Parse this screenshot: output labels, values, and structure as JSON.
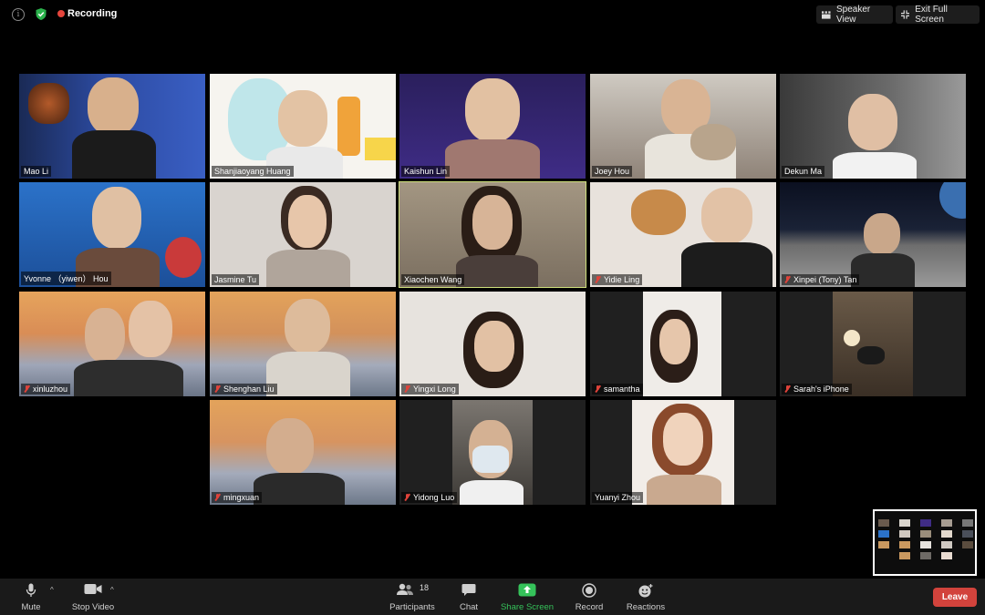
{
  "topbar": {
    "recording_label": "Recording",
    "speaker_view_label": "Speaker View",
    "exit_fullscreen_label": "Exit Full Screen"
  },
  "participants": [
    {
      "name": "Mao Li",
      "muted": false
    },
    {
      "name": "Shanjiaoyang Huang",
      "muted": false
    },
    {
      "name": "Kaishun Lin",
      "muted": false
    },
    {
      "name": "Joey Hou",
      "muted": false
    },
    {
      "name": "Dekun Ma",
      "muted": false
    },
    {
      "name": "Yvonne （yiwen） Hou",
      "muted": false
    },
    {
      "name": "Jasmine Tu",
      "muted": false
    },
    {
      "name": "Xiaochen Wang",
      "muted": false,
      "active_speaker": true
    },
    {
      "name": "Yidie Ling",
      "muted": true
    },
    {
      "name": "Xinpei (Tony) Tan",
      "muted": true
    },
    {
      "name": "xinluzhou",
      "muted": true
    },
    {
      "name": "Shenghan Liu",
      "muted": true
    },
    {
      "name": "Yingxi Long",
      "muted": true
    },
    {
      "name": "samantha",
      "muted": true
    },
    {
      "name": "Sarah's iPhone",
      "muted": true
    },
    {
      "name": "mingxuan",
      "muted": true
    },
    {
      "name": "Yidong Luo",
      "muted": true
    },
    {
      "name": "Yuanyi Zhou",
      "muted": false
    }
  ],
  "toolbar": {
    "mute_label": "Mute",
    "stop_video_label": "Stop Video",
    "participants_label": "Participants",
    "participants_count": "18",
    "chat_label": "Chat",
    "share_screen_label": "Share Screen",
    "record_label": "Record",
    "reactions_label": "Reactions",
    "leave_label": "Leave"
  },
  "colors": {
    "accent_active": "#cfe07c",
    "share_green": "#35c25a",
    "leave_red": "#d2433c",
    "recording_red": "#e5453c"
  }
}
